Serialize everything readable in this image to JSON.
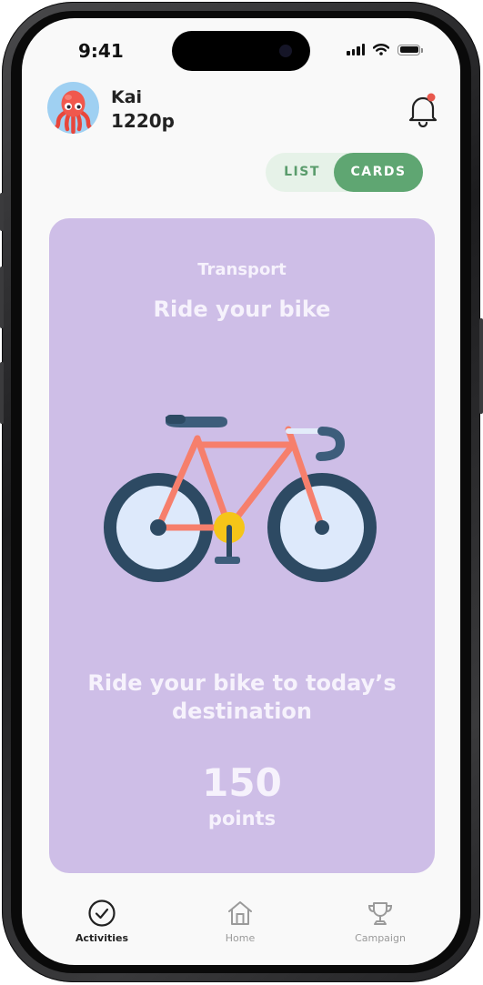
{
  "status_bar": {
    "time": "9:41"
  },
  "header": {
    "user_name": "Kai",
    "user_points": "1220p",
    "avatar_icon": "octopus-avatar",
    "notification_icon": "bell-icon",
    "has_unread": true
  },
  "view_toggle": {
    "list_label": "LIST",
    "cards_label": "CARDS",
    "selected": "CARDS"
  },
  "card": {
    "category": "Transport",
    "title": "Ride your bike",
    "illustration": "bicycle-icon",
    "description": "Ride your bike to today’s destination",
    "points_value": "150",
    "points_label": "points",
    "background_color": "#cebee7"
  },
  "tab_bar": {
    "items": [
      {
        "label": "Activities",
        "icon": "check-circle-icon",
        "active": true
      },
      {
        "label": "Home",
        "icon": "home-icon",
        "active": false
      },
      {
        "label": "Campaign",
        "icon": "trophy-icon",
        "active": false
      }
    ]
  },
  "colors": {
    "accent_green": "#5fa672",
    "toggle_bg": "#e6f2e8",
    "notification_dot": "#e8584d"
  }
}
